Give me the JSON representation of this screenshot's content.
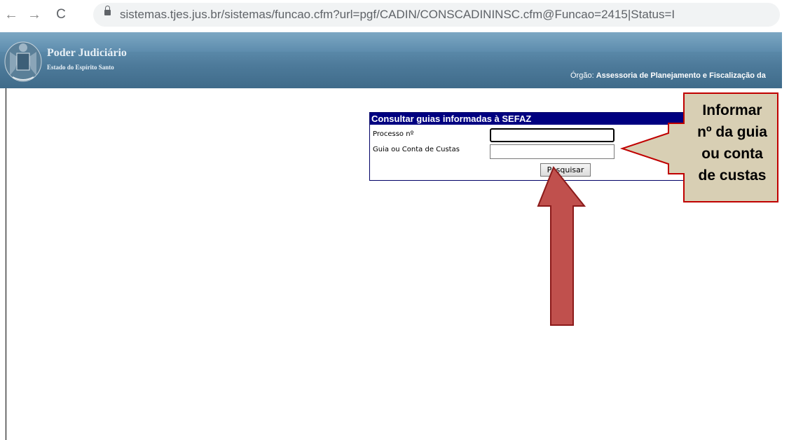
{
  "browser": {
    "url": "sistemas.tjes.jus.br/sistemas/funcao.cfm?url=pgf/CADIN/CONSCADININSC.cfm@Funcao=2415|Status=I"
  },
  "header": {
    "title": "Poder Judiciário",
    "subtitle": "Estado do Espírito Santo",
    "org_label": "Órgão:",
    "org_value": "Assessoria de Planejamento e Fiscalização da"
  },
  "form": {
    "heading": "Consultar guias informadas à SEFAZ",
    "processo_label": "Processo nº",
    "processo_value": "",
    "guia_label": "Guia ou Conta de Custas",
    "guia_value": "",
    "search_label": "Pesquisar"
  },
  "annotation": {
    "callout_lines": [
      "Informar",
      "nº da guia",
      "ou conta",
      "de custas"
    ]
  },
  "colors": {
    "banner": "#4d7a9a",
    "form_header": "#000080",
    "callout_fill": "#d8cfb4",
    "callout_border": "#c00000",
    "arrow_fill": "#c0504d",
    "arrow_border": "#8b1a1a"
  }
}
